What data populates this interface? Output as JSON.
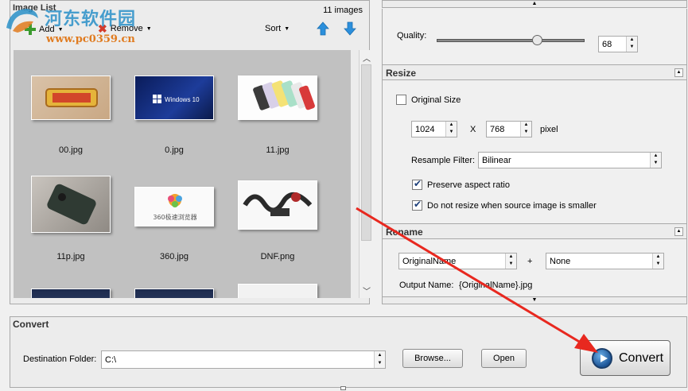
{
  "image_list": {
    "title": "Image List",
    "count": "11 images",
    "toolbar": {
      "add": "Add",
      "remove": "Remove",
      "sort": "Sort"
    },
    "items": [
      {
        "label": "00.jpg",
        "art": "game"
      },
      {
        "label": "0.jpg",
        "art": "windows"
      },
      {
        "label": "11.jpg",
        "art": "phones"
      },
      {
        "label": "11p.jpg",
        "art": "phone-dark"
      },
      {
        "label": "360.jpg",
        "art": "browser"
      },
      {
        "label": "DNF.png",
        "art": "calligraphy"
      },
      {
        "label": "",
        "art": "dark-ui"
      },
      {
        "label": "",
        "art": "dark-ui"
      },
      {
        "label": "",
        "art": "white-ui"
      }
    ],
    "thumb_texts": {
      "windows": "Windows 10",
      "browser": "360极速浏览器"
    }
  },
  "quality": {
    "label": "Quality:",
    "value": "68",
    "level": 68
  },
  "resize": {
    "title": "Resize",
    "original_size": "Original Size",
    "original_size_checked": false,
    "width": "1024",
    "x_label": "X",
    "height": "768",
    "unit": "pixel",
    "resample_label": "Resample Filter:",
    "resample_value": "Bilinear",
    "preserve_label": "Preserve aspect ratio",
    "preserve_checked": true,
    "noresize_label": "Do not resize when source image is smaller",
    "noresize_checked": true
  },
  "rename": {
    "title": "Rename",
    "first": "OriginalName",
    "plus": "+",
    "second": "None",
    "output_label": "Output Name:",
    "output_value": "{OriginalName}.jpg"
  },
  "convert": {
    "title": "Convert",
    "dest_label": "Destination Folder:",
    "dest_value": "C:\\",
    "browse": "Browse...",
    "open": "Open",
    "convert": "Convert"
  },
  "watermark": {
    "main": "河东软件园",
    "url": "www.pc0359.cn"
  },
  "colors": {
    "accent": "#1d5597",
    "annotation": "#e8281f",
    "watermark_blue": "#2a90c8",
    "watermark_orange": "#e07b1f"
  }
}
